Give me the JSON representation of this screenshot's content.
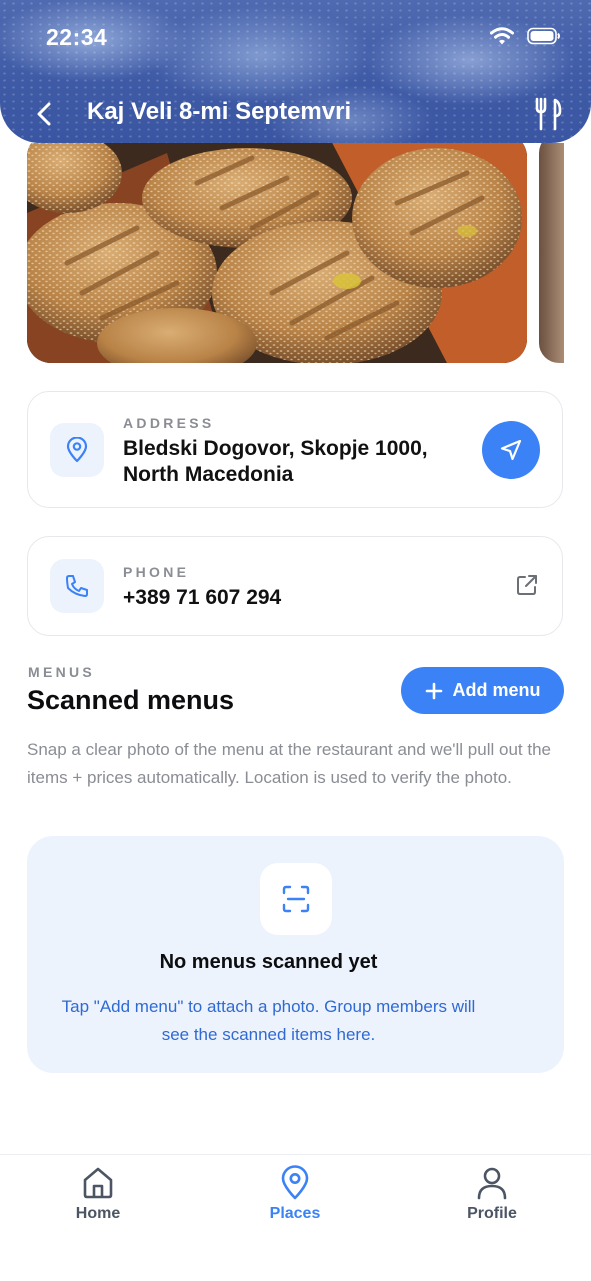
{
  "status_bar": {
    "time": "22:34",
    "wifi_icon": "wifi-icon",
    "battery_icon": "battery-icon"
  },
  "header": {
    "title": "Kaj Veli 8-mi Septemvri",
    "back_icon": "chevron-left-icon",
    "action_icon": "cutlery-icon"
  },
  "gallery": {
    "photos": [
      "bread-photo",
      "next-photo"
    ]
  },
  "address": {
    "label": "ADDRESS",
    "line1": "Bledski Dogovor, Skopje 1000,",
    "line2": "North Macedonia",
    "icon": "map-pin-icon",
    "action_icon": "navigation-arrow-icon"
  },
  "phone": {
    "label": "PHONE",
    "value": "+389 71 607 294",
    "icon": "phone-icon",
    "action_icon": "external-link-icon"
  },
  "menus": {
    "kicker": "MENUS",
    "title": "Scanned menus",
    "add_button": "Add menu",
    "description": "Snap a clear photo of the menu at the restaurant and we'll pull out the items + prices automatically. Location is used to verify the photo.",
    "empty_title": "No menus scanned yet",
    "empty_description": "Tap \"Add menu\" to attach a photo. Group members will see the scanned items here."
  },
  "tabbar": {
    "items": [
      {
        "label": "Home",
        "icon": "home-icon",
        "active": false
      },
      {
        "label": "Places",
        "icon": "map-pin-icon",
        "active": true
      },
      {
        "label": "Profile",
        "icon": "user-icon",
        "active": false
      }
    ]
  },
  "colors": {
    "accent": "#3b82f6",
    "muted": "#8a8d93",
    "tint": "#edf3fd",
    "link": "#2f6ad3"
  }
}
